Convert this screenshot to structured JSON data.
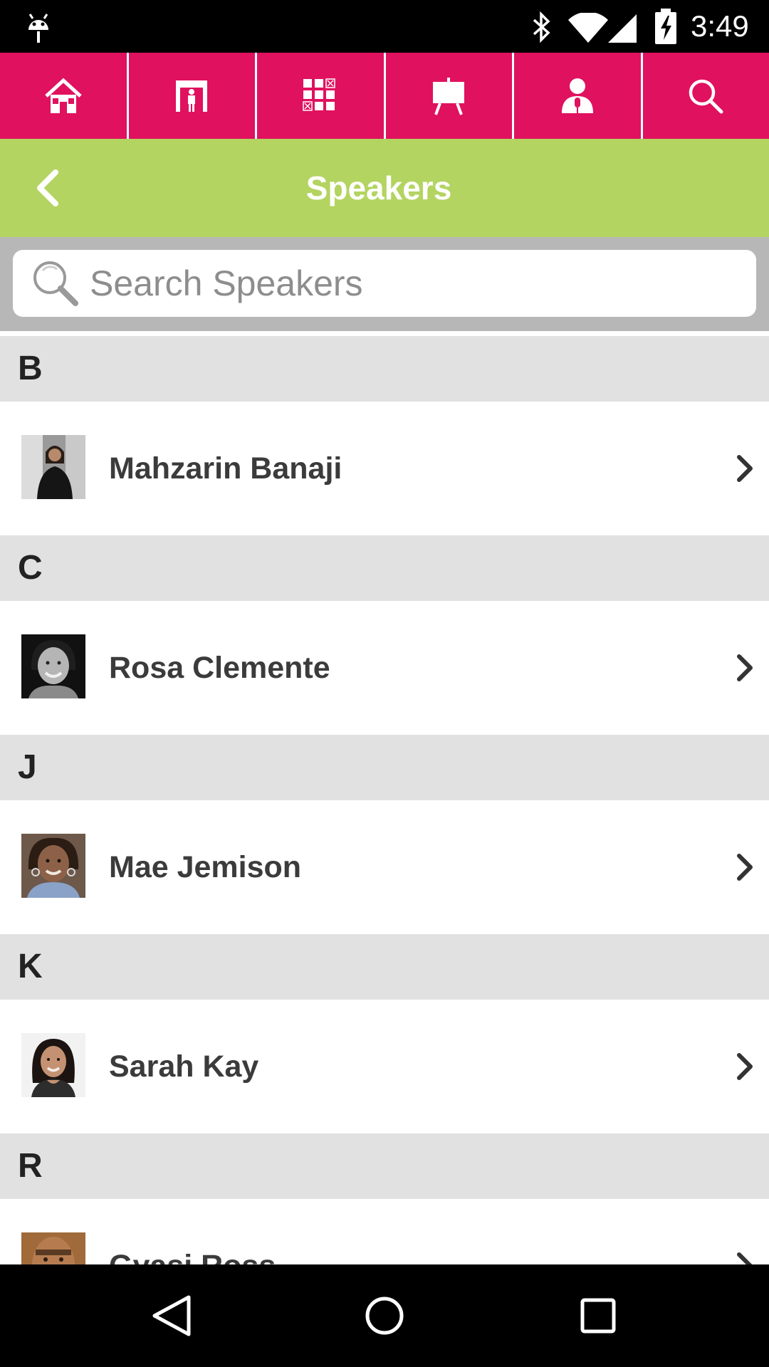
{
  "status_bar": {
    "time": "3:49",
    "icons": [
      "android-notification-icon",
      "bluetooth-icon",
      "wifi-icon",
      "cell-signal-icon",
      "battery-charging-icon"
    ]
  },
  "top_nav": {
    "items": [
      {
        "icon": "home-icon"
      },
      {
        "icon": "exhibitor-booth-icon"
      },
      {
        "icon": "floor-map-icon"
      },
      {
        "icon": "presentation-easel-icon"
      },
      {
        "icon": "speaker-microphone-icon"
      },
      {
        "icon": "search-icon"
      }
    ],
    "color": "#e0115f"
  },
  "header": {
    "title": "Speakers",
    "back_icon": "chevron-left-icon",
    "color": "#b3d461"
  },
  "search": {
    "placeholder": "Search Speakers",
    "value": ""
  },
  "sections": [
    {
      "letter": "B",
      "speakers": [
        {
          "name": "Mahzarin Banaji"
        }
      ]
    },
    {
      "letter": "C",
      "speakers": [
        {
          "name": "Rosa Clemente"
        }
      ]
    },
    {
      "letter": "J",
      "speakers": [
        {
          "name": "Mae Jemison"
        }
      ]
    },
    {
      "letter": "K",
      "speakers": [
        {
          "name": "Sarah Kay"
        }
      ]
    },
    {
      "letter": "R",
      "speakers": [
        {
          "name": "Gyasi Ross"
        }
      ]
    }
  ],
  "system_nav": {
    "icons": [
      "back-triangle-icon",
      "home-circle-icon",
      "recent-apps-square-icon"
    ]
  }
}
